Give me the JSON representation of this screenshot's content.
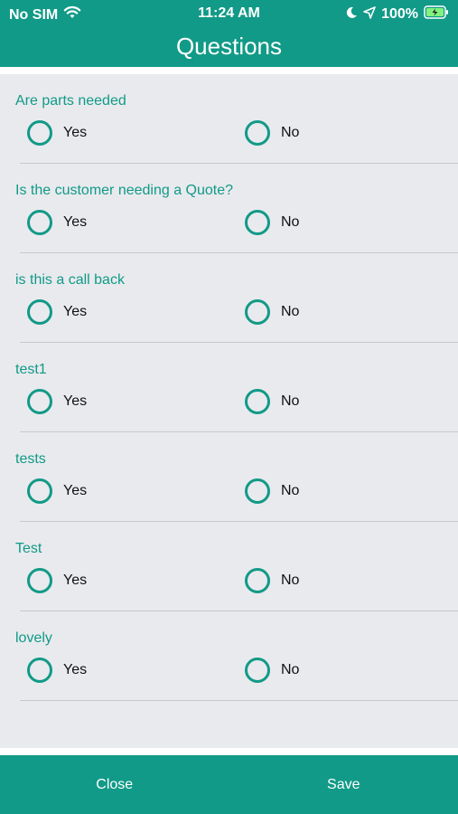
{
  "status_bar": {
    "carrier": "No SIM",
    "time": "11:24 AM",
    "battery": "100%"
  },
  "header": {
    "title": "Questions"
  },
  "questions": [
    {
      "label": "Are parts needed",
      "yes": "Yes",
      "no": "No"
    },
    {
      "label": "Is the customer needing a Quote?",
      "yes": "Yes",
      "no": "No"
    },
    {
      "label": "is this a call back",
      "yes": "Yes",
      "no": "No"
    },
    {
      "label": "test1",
      "yes": "Yes",
      "no": "No"
    },
    {
      "label": "tests",
      "yes": "Yes",
      "no": "No"
    },
    {
      "label": "Test",
      "yes": "Yes",
      "no": "No"
    },
    {
      "label": "lovely",
      "yes": "Yes",
      "no": "No"
    }
  ],
  "footer": {
    "close_label": "Close",
    "save_label": "Save"
  },
  "colors": {
    "accent": "#119a87",
    "background": "#e9eaee"
  },
  "icons": [
    "wifi-icon",
    "moon-icon",
    "location-arrow-icon",
    "battery-icon"
  ]
}
